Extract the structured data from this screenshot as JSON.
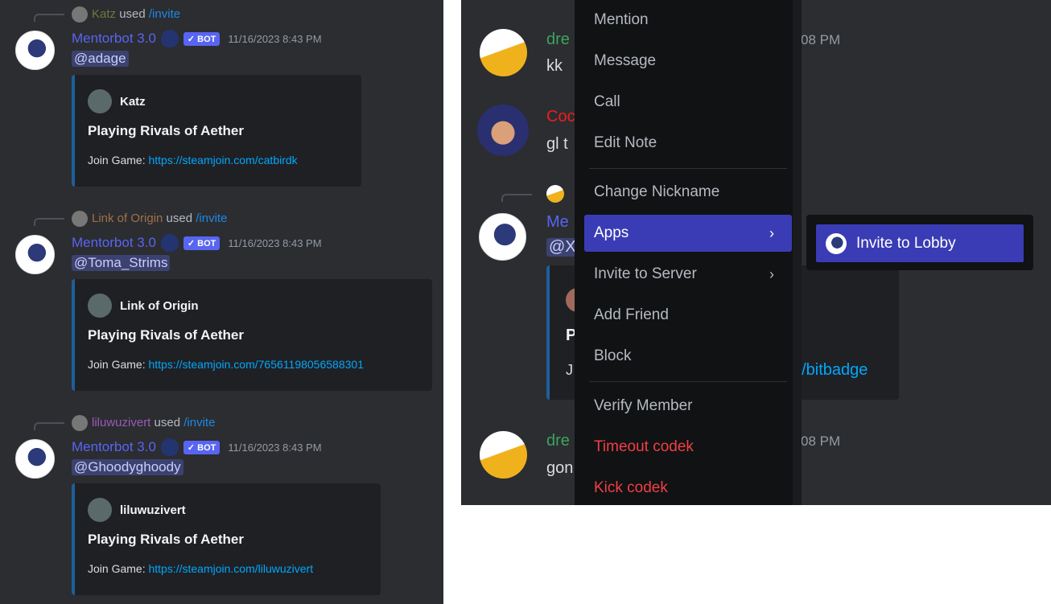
{
  "left_messages": [
    {
      "user": "Katz",
      "user_color": "#6b7a3a",
      "used": "used",
      "command": "/invite",
      "bot": "Mentorbot 3.0",
      "badge": "✓ BOT",
      "timestamp": "11/16/2023 8:43 PM",
      "mention": "@adage",
      "embed": {
        "author": "Katz",
        "title": "Playing Rivals of Aether",
        "label": "Join Game:",
        "link": "https://steamjoin.com/catbirdk"
      }
    },
    {
      "user": "Link of Origin",
      "user_color": "#a0714a",
      "used": "used",
      "command": "/invite",
      "bot": "Mentorbot 3.0",
      "badge": "✓ BOT",
      "timestamp": "11/16/2023 8:43 PM",
      "mention": "@Toma_Strims",
      "embed": {
        "author": "Link of Origin",
        "title": "Playing Rivals of Aether",
        "label": "Join Game:",
        "link": "https://steamjoin.com/76561198056588301"
      }
    },
    {
      "user": "liluwuzivert",
      "user_color": "#9b59b6",
      "used": "used",
      "command": "/invite",
      "bot": "Mentorbot 3.0",
      "badge": "✓ BOT",
      "timestamp": "11/16/2023 8:43 PM",
      "mention": "@Ghoodyghoody",
      "embed": {
        "author": "liluwuzivert",
        "title": "Playing Rivals of Aether",
        "label": "Join Game:",
        "link": "https://steamjoin.com/liluwuzivert"
      }
    }
  ],
  "background": {
    "msg1": {
      "name": "dre",
      "text": "kk",
      "time": "08 PM"
    },
    "msg2": {
      "name": "Coc",
      "text": "gl t"
    },
    "msg3": {
      "name": "Me",
      "mention": "@X",
      "embed_title": "P",
      "embed_desc": "J",
      "embed_link": "n/bitbadge"
    },
    "msg4": {
      "name": "dre",
      "text": "gon",
      "time": "08 PM"
    }
  },
  "context_menu": {
    "items": [
      "Mention",
      "Message",
      "Call",
      "Edit Note",
      "Change Nickname",
      "Apps",
      "Invite to Server",
      "Add Friend",
      "Block",
      "Verify Member",
      "Timeout codek",
      "Kick codek"
    ],
    "active": "Apps",
    "chevron": "›"
  },
  "submenu": {
    "item": "Invite to Lobby"
  },
  "colors": {
    "accent": "#5865f2",
    "menu_active": "#3a3cb5",
    "danger": "#f23f43",
    "link": "#00a8fc"
  }
}
